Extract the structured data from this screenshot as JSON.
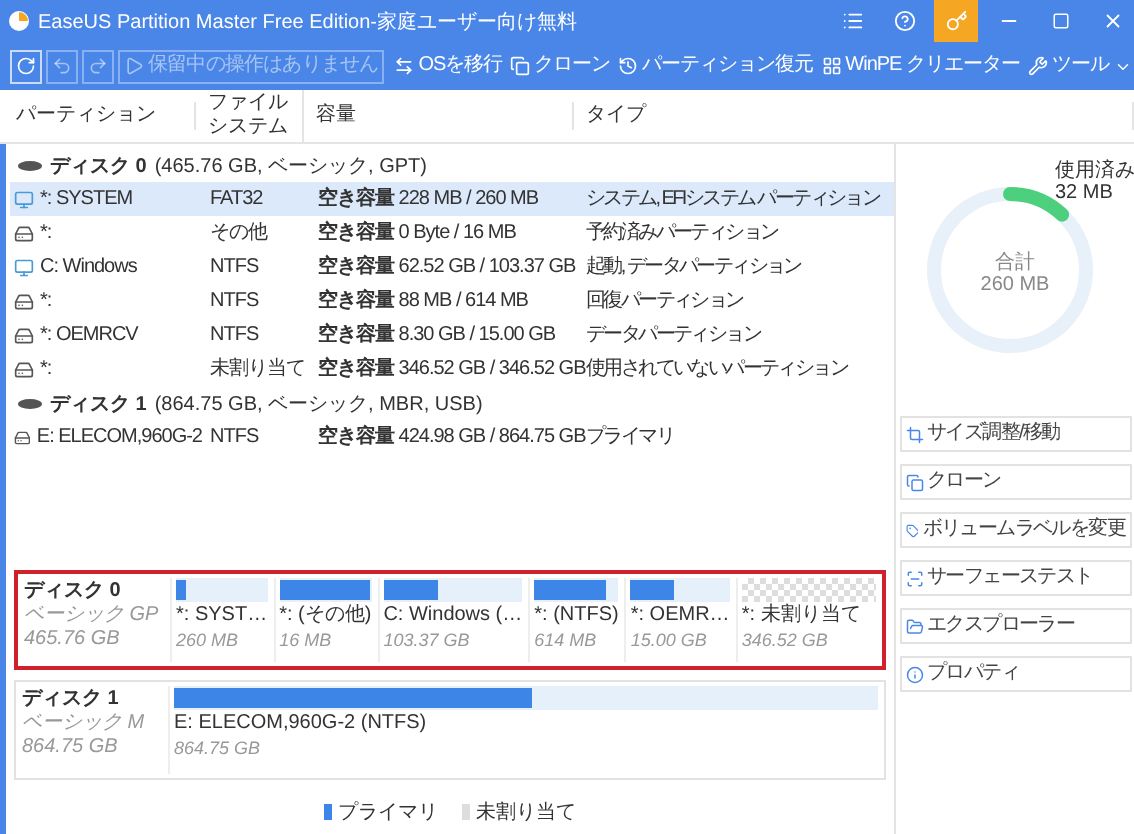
{
  "window": {
    "title": "EaseUS Partition Master Free Edition-家庭ユーザー向け無料"
  },
  "toolbar": {
    "left": [
      {
        "kind": "refresh",
        "disabled": false
      },
      {
        "kind": "undo",
        "disabled": true
      },
      {
        "kind": "redo",
        "disabled": true
      },
      {
        "kind": "apply",
        "label": "保留中の操作はありません",
        "disabled": true
      }
    ],
    "right": [
      {
        "kind": "migrate",
        "label": "OSを移行"
      },
      {
        "kind": "clone",
        "label": "クローン"
      },
      {
        "kind": "recover",
        "label": "パーティション復元"
      },
      {
        "kind": "winpe",
        "label": "WinPE クリエーター"
      },
      {
        "kind": "tools",
        "label": "ツール"
      }
    ]
  },
  "table": {
    "columns": [
      "パーティション",
      "ファイルシステム",
      "容量",
      "タイプ"
    ],
    "disks": [
      {
        "name": "ディスク 0",
        "info": "(465.76 GB, ベーシック, GPT)",
        "rows": [
          {
            "kind": "system",
            "name": "*: SYSTEM",
            "fs": "FAT32",
            "capacity_label": "空き容量",
            "capacity": "228 MB / 260 MB",
            "type": "システム, EFIシステム パーティション",
            "selected": true
          },
          {
            "kind": "drive",
            "name": "*:",
            "fs": "その他",
            "capacity_label": "空き容量",
            "capacity": "0 Byte / 16 MB",
            "type": "予約済みパーティション",
            "selected": false
          },
          {
            "kind": "system",
            "name": "C: Windows",
            "fs": "NTFS",
            "capacity_label": "空き容量",
            "capacity": "62.52 GB / 103.37 GB",
            "type": "起動, データパーティション",
            "selected": false
          },
          {
            "kind": "drive",
            "name": "*:",
            "fs": "NTFS",
            "capacity_label": "空き容量",
            "capacity": "88 MB / 614 MB",
            "type": "回復パーティション",
            "selected": false
          },
          {
            "kind": "drive",
            "name": "*: OEMRCV",
            "fs": "NTFS",
            "capacity_label": "空き容量",
            "capacity": "8.30 GB / 15.00 GB",
            "type": "データパーティション",
            "selected": false
          },
          {
            "kind": "drive",
            "name": "*:",
            "fs": "未割り当て",
            "capacity_label": "空き容量",
            "capacity": "346.52 GB / 346.52 GB",
            "type": "使用されていないパーティション",
            "selected": false
          }
        ]
      },
      {
        "name": "ディスク 1",
        "info": "(864.75 GB, ベーシック, MBR, USB)",
        "rows": [
          {
            "kind": "drive",
            "name": "E: ELECOM,960G-2",
            "fs": "NTFS",
            "capacity_label": "空き容量",
            "capacity": "424.98 GB / 864.75 GB",
            "type": "プライマリ",
            "selected": false
          }
        ]
      }
    ]
  },
  "usage": {
    "used_label": "使用済み",
    "used": "32 MB",
    "total_label": "合計",
    "total": "260 MB",
    "level": 0.12
  },
  "actions": [
    {
      "kind": "resize",
      "label": "サイズ調整/移動"
    },
    {
      "kind": "clone",
      "label": "クローン"
    },
    {
      "kind": "label",
      "label": "ボリュームラベルを変更"
    },
    {
      "kind": "surface",
      "label": "サーフェーステスト"
    },
    {
      "kind": "explorer",
      "label": "エクスプローラー"
    },
    {
      "kind": "properties",
      "label": "プロパティ"
    }
  ],
  "disk_map": [
    {
      "name": "ディスク 0",
      "style": "ベーシック GP",
      "size": "465.76 GB",
      "selected": true,
      "segments": [
        {
          "kind": "primary",
          "label": "*: SYST…",
          "size": "260 MB",
          "level": 0.12
        },
        {
          "kind": "primary",
          "label": "*: (その他)",
          "size": "16 MB",
          "level": 1
        },
        {
          "kind": "primary",
          "label": "C: Windows (…",
          "size": "103.37 GB",
          "level": 0.4
        },
        {
          "kind": "primary",
          "label": "*: (NTFS)",
          "size": "614 MB",
          "level": 0.86
        },
        {
          "kind": "primary",
          "label": "*: OEMR…",
          "size": "15.00 GB",
          "level": 0.45
        },
        {
          "kind": "unallocated",
          "label": "*: 未割り当て",
          "size": "346.52 GB"
        }
      ]
    },
    {
      "name": "ディスク 1",
      "style": "ベーシック M",
      "size": "864.75 GB",
      "selected": false,
      "segments": [
        {
          "kind": "primary",
          "label": "E: ELECOM,960G-2 (NTFS)",
          "size": "864.75 GB",
          "level": 0.51
        }
      ]
    }
  ],
  "legend": [
    {
      "kind": "primary",
      "label": "プライマリ"
    },
    {
      "kind": "unallocated",
      "label": "未割り当て"
    }
  ]
}
